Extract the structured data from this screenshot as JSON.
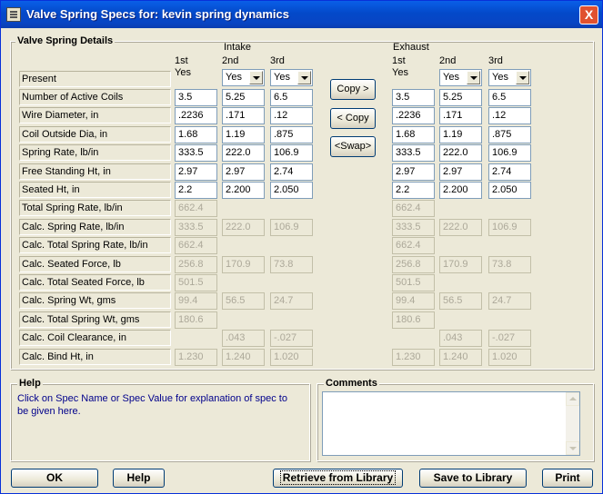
{
  "window": {
    "title": "Valve Spring Specs for: kevin spring dynamics",
    "close_label": "X"
  },
  "details_title": "Valve Spring Details",
  "intake_label": "Intake",
  "exhaust_label": "Exhaust",
  "col_labels": [
    "1st",
    "2nd",
    "3rd"
  ],
  "present_first": "Yes",
  "present_combo_values": [
    "Yes",
    "Yes",
    "Yes",
    "Yes"
  ],
  "rows": [
    {
      "name": "Present",
      "type": "present"
    },
    {
      "name": "Number of Active Coils",
      "intake": [
        "3.5",
        "5.25",
        "6.5"
      ],
      "exhaust": [
        "3.5",
        "5.25",
        "6.5"
      ],
      "disabled": false
    },
    {
      "name": "Wire Diameter, in",
      "intake": [
        ".2236",
        ".171",
        ".12"
      ],
      "exhaust": [
        ".2236",
        ".171",
        ".12"
      ],
      "disabled": false
    },
    {
      "name": "Coil Outside Dia, in",
      "intake": [
        "1.68",
        "1.19",
        ".875"
      ],
      "exhaust": [
        "1.68",
        "1.19",
        ".875"
      ],
      "disabled": false
    },
    {
      "name": "Spring Rate, lb/in",
      "intake": [
        "333.5",
        "222.0",
        "106.9"
      ],
      "exhaust": [
        "333.5",
        "222.0",
        "106.9"
      ],
      "disabled": false
    },
    {
      "name": "Free Standing Ht, in",
      "intake": [
        "2.97",
        "2.97",
        "2.74"
      ],
      "exhaust": [
        "2.97",
        "2.97",
        "2.74"
      ],
      "disabled": false
    },
    {
      "name": "Seated Ht, in",
      "intake": [
        "2.2",
        "2.200",
        "2.050"
      ],
      "exhaust": [
        "2.2",
        "2.200",
        "2.050"
      ],
      "disabled": false
    },
    {
      "name": "Total Spring Rate, lb/in",
      "intake": [
        "662.4"
      ],
      "exhaust": [
        "662.4"
      ],
      "disabled": true
    },
    {
      "name": "Calc. Spring Rate, lb/in",
      "intake": [
        "333.5",
        "222.0",
        "106.9"
      ],
      "exhaust": [
        "333.5",
        "222.0",
        "106.9"
      ],
      "disabled": true
    },
    {
      "name": "Calc. Total Spring Rate, lb/in",
      "intake": [
        "662.4"
      ],
      "exhaust": [
        "662.4"
      ],
      "disabled": true
    },
    {
      "name": "Calc. Seated Force, lb",
      "intake": [
        "256.8",
        "170.9",
        "73.8"
      ],
      "exhaust": [
        "256.8",
        "170.9",
        "73.8"
      ],
      "disabled": true
    },
    {
      "name": "Calc. Total Seated Force, lb",
      "intake": [
        "501.5"
      ],
      "exhaust": [
        "501.5"
      ],
      "disabled": true
    },
    {
      "name": "Calc. Spring Wt, gms",
      "intake": [
        "99.4",
        "56.5",
        "24.7"
      ],
      "exhaust": [
        "99.4",
        "56.5",
        "24.7"
      ],
      "disabled": true
    },
    {
      "name": "Calc. Total Spring Wt, gms",
      "intake": [
        "180.6"
      ],
      "exhaust": [
        "180.6"
      ],
      "disabled": true
    },
    {
      "name": "Calc. Coil Clearance, in",
      "intake": [
        "",
        ".043",
        "-.027"
      ],
      "exhaust": [
        "",
        ".043",
        "-.027"
      ],
      "disabled": true
    },
    {
      "name": "Calc. Bind Ht, in",
      "intake": [
        "1.230",
        "1.240",
        "1.020"
      ],
      "exhaust": [
        "1.230",
        "1.240",
        "1.020"
      ],
      "disabled": true
    }
  ],
  "copy_buttons": {
    "copy_right": "Copy >",
    "copy_left": "< Copy",
    "swap": "<Swap>"
  },
  "help": {
    "title": "Help",
    "text": "Click on Spec Name or Spec Value for explanation of spec to be given here."
  },
  "comments": {
    "title": "Comments",
    "value": ""
  },
  "bottom_buttons": {
    "ok": "OK",
    "help": "Help",
    "retrieve": "Retrieve from Library",
    "save": "Save to Library",
    "print": "Print"
  }
}
